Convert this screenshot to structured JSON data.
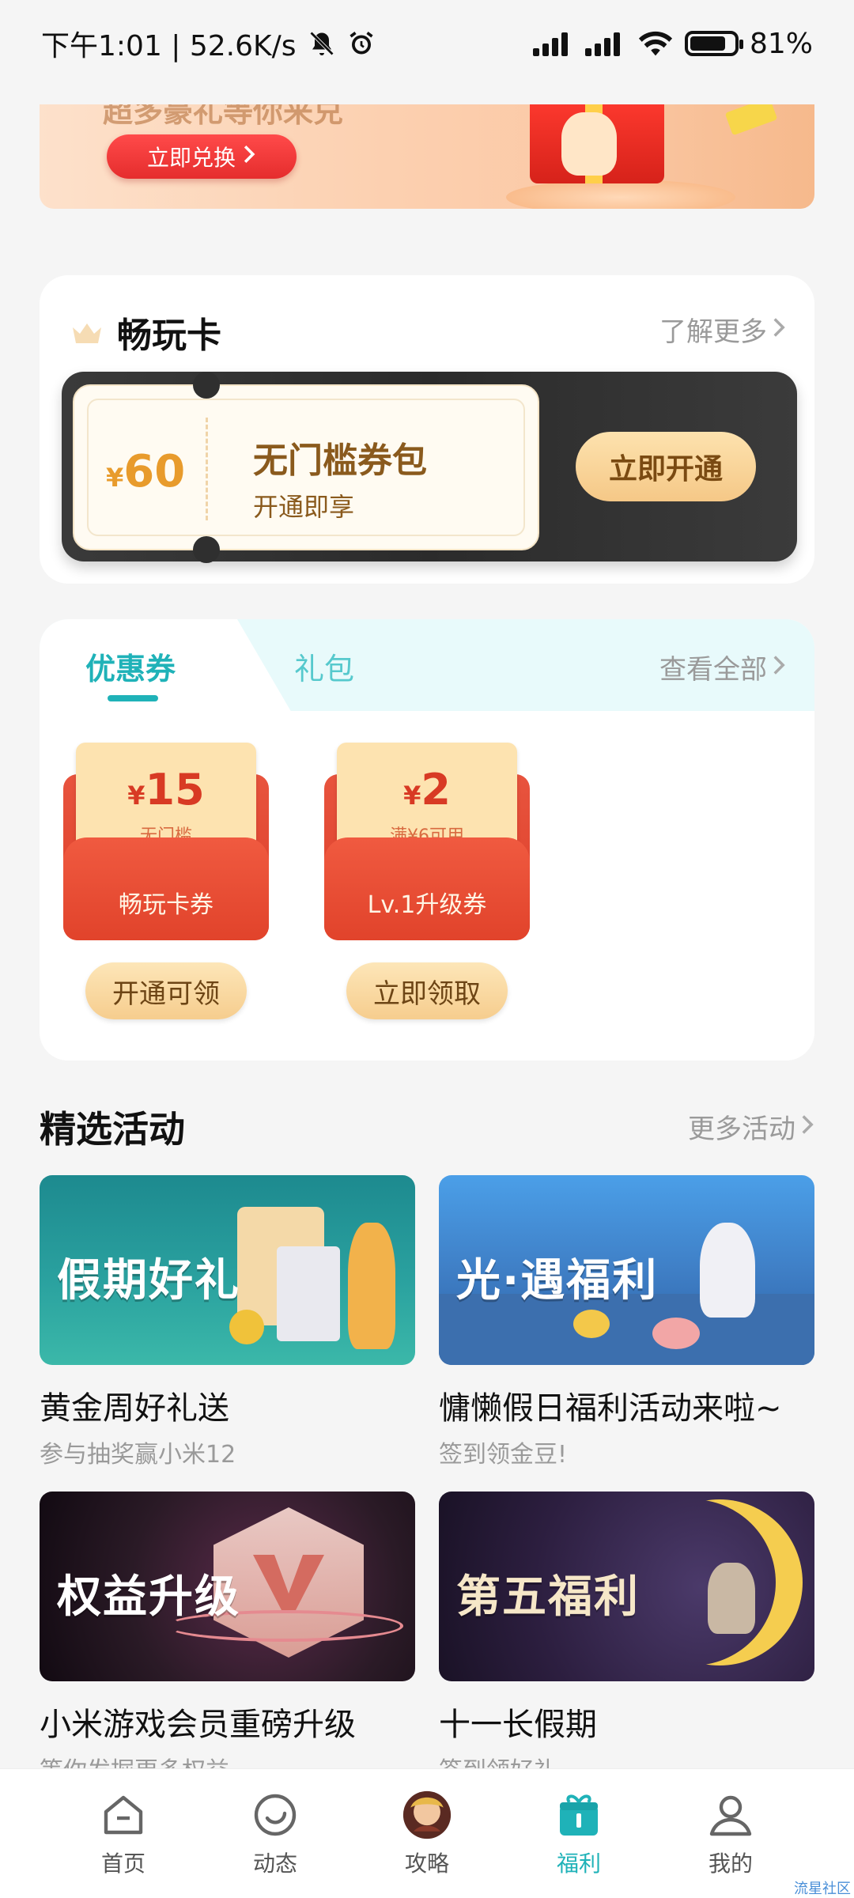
{
  "status_bar": {
    "time_speed": "下午1:01 | 52.6K/s",
    "battery": "81%",
    "battery_level": 0.81
  },
  "banner": {
    "faded_text": "超多豪礼等你来兑",
    "button_label": "立即兑换"
  },
  "vip_card": {
    "title": "畅玩卡",
    "more": "了解更多",
    "ticket": {
      "currency": "¥",
      "amount": "60",
      "title": "无门槛券包",
      "subtitle": "开通即享"
    },
    "open_button": "立即开通"
  },
  "coupons": {
    "tabs": [
      "优惠券",
      "礼包"
    ],
    "active_tab": "优惠券",
    "more": "查看全部",
    "items": [
      {
        "currency": "¥",
        "amount": "15",
        "condition": "无门槛",
        "name": "畅玩卡券",
        "button": "开通可领"
      },
      {
        "currency": "¥",
        "amount": "2",
        "condition": "满¥6可用",
        "name": "Lv.1升级券",
        "button": "立即领取"
      }
    ]
  },
  "featured": {
    "title": "精选活动",
    "more": "更多活动",
    "activities": [
      {
        "image_text": "假期好礼",
        "title": "黄金周好礼送",
        "subtitle": "参与抽奖赢小米12"
      },
      {
        "image_text": "光·遇福利",
        "title": "慵懒假日福利活动来啦~",
        "subtitle": "签到领金豆!"
      },
      {
        "image_text": "权益升级",
        "title": "小米游戏会员重磅升级",
        "subtitle": "等你发掘更多权益"
      },
      {
        "image_text": "第五福利",
        "title": "十一长假期",
        "subtitle": "签到领好礼"
      }
    ]
  },
  "bottom_nav": {
    "items": [
      "首页",
      "动态",
      "攻略",
      "福利",
      "我的"
    ],
    "active": "福利"
  },
  "corner_mark": "流星社区"
}
